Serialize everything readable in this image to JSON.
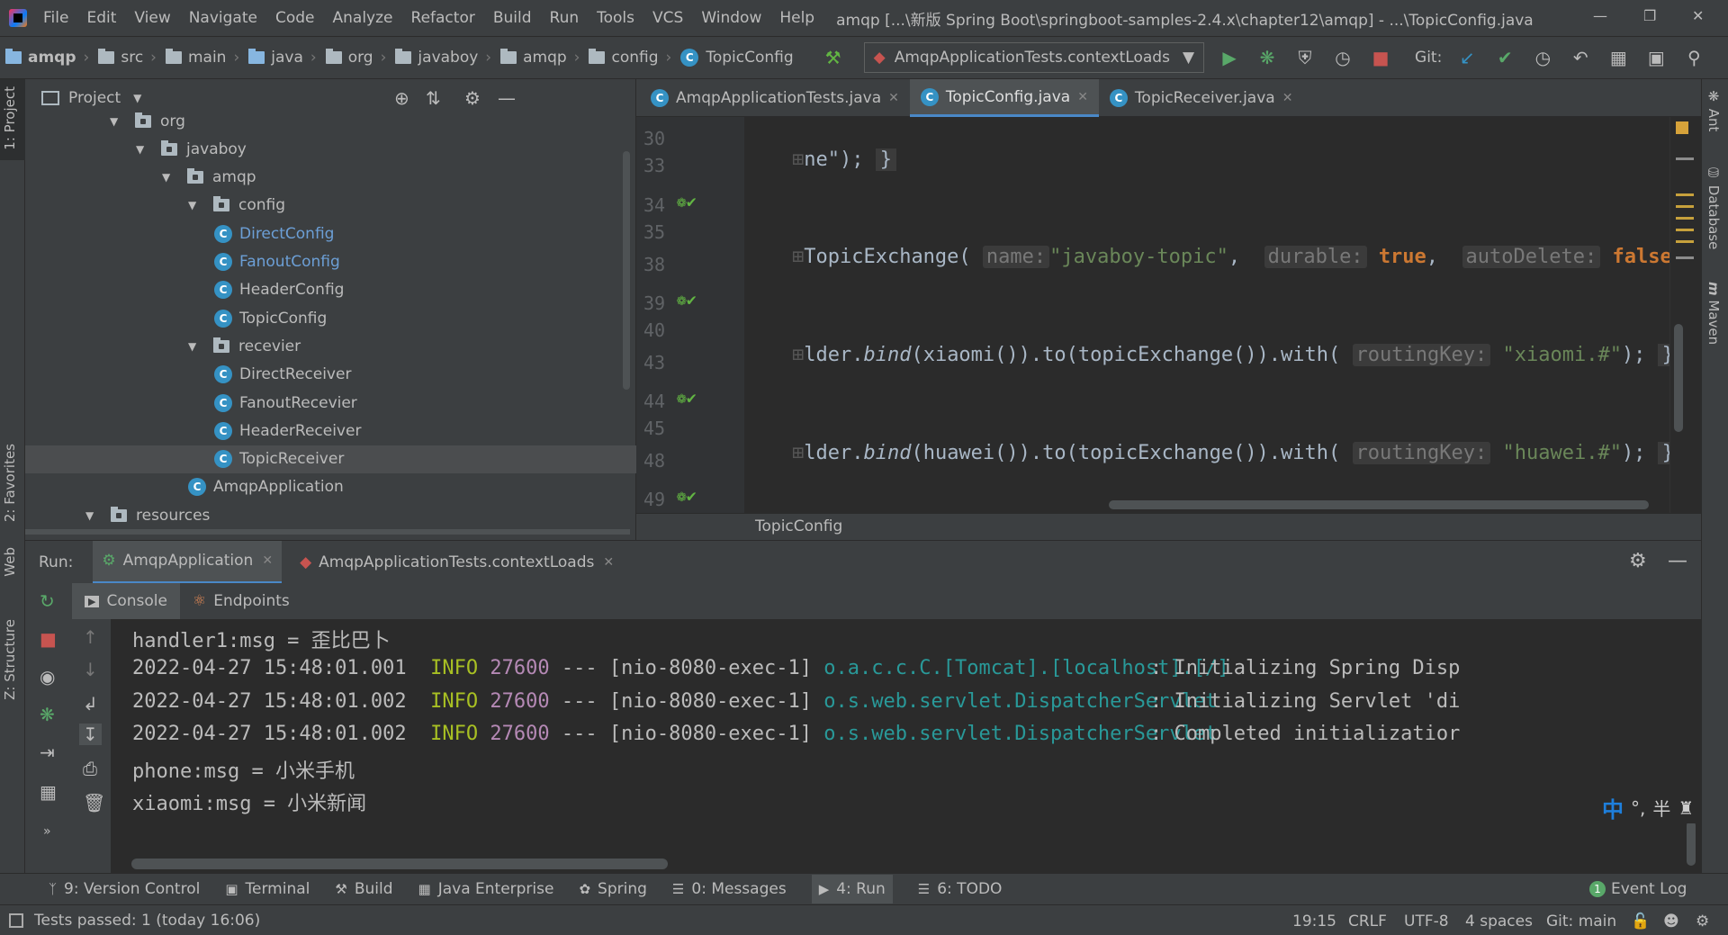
{
  "menu": [
    "File",
    "Edit",
    "View",
    "Navigate",
    "Code",
    "Analyze",
    "Refactor",
    "Build",
    "Run",
    "Tools",
    "VCS",
    "Window",
    "Help"
  ],
  "window_title": "amqp [...\\新版 Spring Boot\\springboot-samples-2.4.x\\chapter12\\amqp] - ...\\TopicConfig.java",
  "breadcrumbs": [
    "amqp",
    "src",
    "main",
    "java",
    "org",
    "javaboy",
    "amqp",
    "config",
    "TopicConfig"
  ],
  "run_config": "AmqpApplicationTests.contextLoads",
  "git_label": "Git:",
  "left_strip": {
    "project": "1: Project",
    "favorites": "2: Favorites",
    "web": "Web",
    "structure": "Z: Structure"
  },
  "right_strip": {
    "ant": "Ant",
    "database": "Database",
    "maven": "Maven"
  },
  "project_panel": {
    "title": "Project",
    "tree": [
      {
        "label": "org",
        "kind": "folder",
        "level": 0
      },
      {
        "label": "javaboy",
        "kind": "folder",
        "level": 1
      },
      {
        "label": "amqp",
        "kind": "folder",
        "level": 2
      },
      {
        "label": "config",
        "kind": "folder",
        "level": 3
      },
      {
        "label": "DirectConfig",
        "kind": "class",
        "level": 4
      },
      {
        "label": "FanoutConfig",
        "kind": "class",
        "level": 4
      },
      {
        "label": "HeaderConfig",
        "kind": "class",
        "level": 4
      },
      {
        "label": "TopicConfig",
        "kind": "class",
        "level": 4
      },
      {
        "label": "recevier",
        "kind": "folder",
        "level": 3
      },
      {
        "label": "DirectReceiver",
        "kind": "class",
        "level": 4
      },
      {
        "label": "FanoutRecevier",
        "kind": "class",
        "level": 4
      },
      {
        "label": "HeaderReceiver",
        "kind": "class",
        "level": 4
      },
      {
        "label": "TopicReceiver",
        "kind": "class",
        "level": 4
      },
      {
        "label": "AmqpApplication",
        "kind": "app",
        "level": 3
      },
      {
        "label": "resources",
        "kind": "folder",
        "level": 0
      }
    ]
  },
  "editor": {
    "tabs": [
      {
        "label": "AmqpApplicationTests.java"
      },
      {
        "label": "TopicConfig.java"
      },
      {
        "label": "TopicReceiver.java"
      }
    ],
    "line_numbers": [
      "30",
      "33",
      "34",
      "35",
      "38",
      "39",
      "40",
      "43",
      "44",
      "45",
      "48",
      "49"
    ],
    "code": {
      "l30": "ne\");",
      "l35_a": "TopicExchange(",
      "l35_hint1": "name:",
      "l35_str": "\"javaboy-topic\"",
      "l35_hint2": "durable:",
      "l35_kw1": "true",
      "l35_hint3": "autoDelete:",
      "l35_kw2": "false",
      "l40_a": "lder.",
      "l40_bind": "bind",
      "l40_b": "(xiaomi()).to(topicExchange()).with(",
      "l40_hint": "routingKey:",
      "l40_str": "\"xiaomi.#\"",
      "l45_a": "lder.",
      "l45_bind": "bind",
      "l45_b": "(huawei()).to(topicExchange()).with(",
      "l45_hint": "routingKey:",
      "l45_str": "\"huawei.#\""
    },
    "breadcrumb": "TopicConfig"
  },
  "run": {
    "title": "Run:",
    "tabs": [
      "AmqpApplication",
      "AmqpApplicationTests.contextLoads"
    ],
    "console_tabs": [
      "Console",
      "Endpoints"
    ],
    "lines": [
      {
        "text": "handler1:msg = 歪比巴卜"
      },
      {
        "ts": "2022-04-27 15:48:01.001",
        "level": "INFO",
        "pid": "27600",
        "sep": "---",
        "thread": "[nio-8080-exec-1]",
        "logger": "o.a.c.c.C.[Tomcat].[localhost].[/]",
        "msg": ": Initializing Spring Disp"
      },
      {
        "ts": "2022-04-27 15:48:01.002",
        "level": "INFO",
        "pid": "27600",
        "sep": "---",
        "thread": "[nio-8080-exec-1]",
        "logger": "o.s.web.servlet.DispatcherServlet",
        "msg": ": Initializing Servlet 'di"
      },
      {
        "ts": "2022-04-27 15:48:01.002",
        "level": "INFO",
        "pid": "27600",
        "sep": "---",
        "thread": "[nio-8080-exec-1]",
        "logger": "o.s.web.servlet.DispatcherServlet",
        "msg": ": Completed initializatior"
      },
      {
        "text": "phone:msg = 小米手机"
      },
      {
        "text": "xiaomi:msg = 小米新闻"
      }
    ]
  },
  "ime": {
    "mode": "中",
    "punct": "°,",
    "width": "半"
  },
  "bottom_tabs": [
    "9: Version Control",
    "Terminal",
    "Build",
    "Java Enterprise",
    "Spring",
    "0: Messages",
    "4: Run",
    "6: TODO"
  ],
  "event_log": {
    "count": "1",
    "label": "Event Log"
  },
  "status": {
    "message": "Tests passed: 1 (today 16:06)",
    "position": "19:15",
    "line_sep": "CRLF",
    "encoding": "UTF-8",
    "indent": "4 spaces",
    "git": "Git: main"
  }
}
